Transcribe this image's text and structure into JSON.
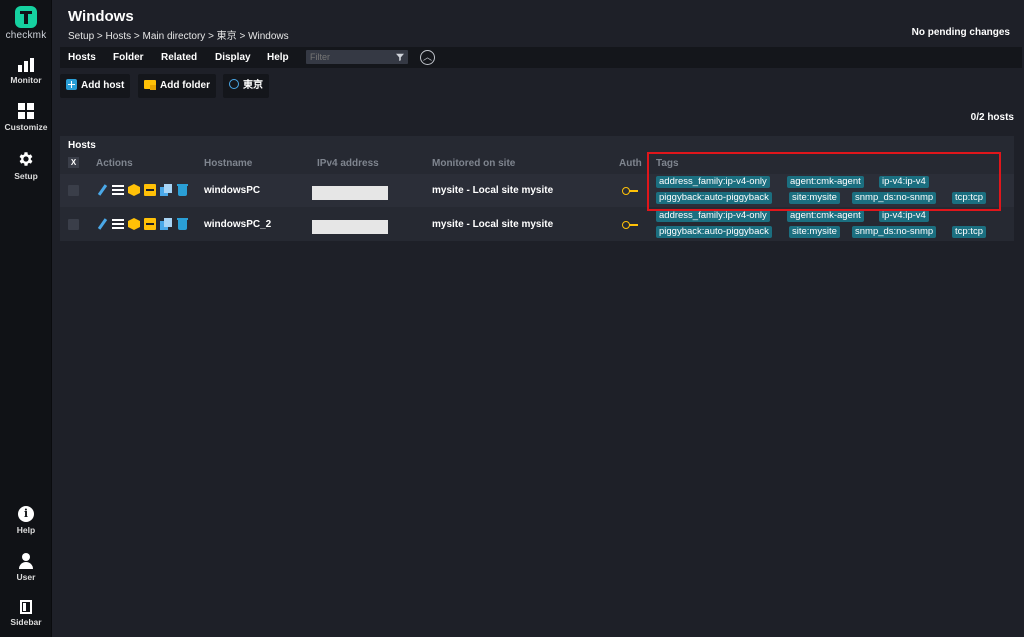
{
  "sidebar": {
    "logo_text": "checkmk",
    "items": [
      {
        "label": "Monitor"
      },
      {
        "label": "Customize"
      },
      {
        "label": "Setup"
      },
      {
        "label": "Help"
      },
      {
        "label": "User"
      },
      {
        "label": "Sidebar"
      }
    ]
  },
  "header": {
    "title": "Windows",
    "breadcrumb": "Setup > Hosts > Main directory > 東京 > Windows",
    "pending": "No pending changes"
  },
  "menubar": {
    "items": [
      "Hosts",
      "Folder",
      "Related",
      "Display",
      "Help"
    ],
    "filter_placeholder": "Filter"
  },
  "actions": {
    "add_host": "Add host",
    "add_folder": "Add folder",
    "folder_link": "東京"
  },
  "host_count": "0/2 hosts",
  "table": {
    "title": "Hosts",
    "columns": [
      "Actions",
      "Hostname",
      "IPv4 address",
      "Monitored on site",
      "Auth",
      "Tags"
    ],
    "select_all": "X",
    "rows": [
      {
        "hostname": "windowsPC",
        "site": "mysite - Local site mysite",
        "tags": [
          "address_family:ip-v4-only",
          "agent:cmk-agent",
          "ip-v4:ip-v4",
          "piggyback:auto-piggyback",
          "site:mysite",
          "snmp_ds:no-snmp",
          "tcp:tcp"
        ]
      },
      {
        "hostname": "windowsPC_2",
        "site": "mysite - Local site mysite",
        "tags": [
          "address_family:ip-v4-only",
          "agent:cmk-agent",
          "ip-v4:ip-v4",
          "piggyback:auto-piggyback",
          "site:mysite",
          "snmp_ds:no-snmp",
          "tcp:tcp"
        ]
      }
    ]
  },
  "colors": {
    "accent": "#15d1a0",
    "tag_bg": "#1b6f80",
    "highlight": "#e0161b",
    "auth_key": "#ffc107"
  }
}
